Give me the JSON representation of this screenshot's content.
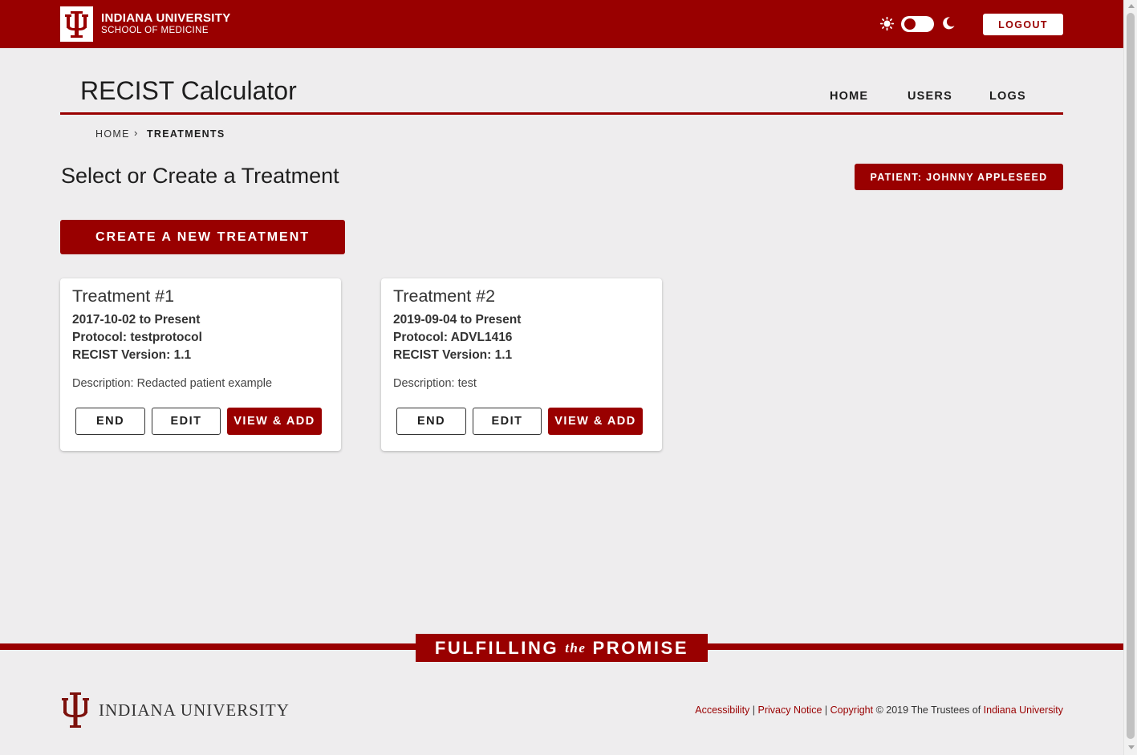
{
  "header": {
    "brand_line1": "INDIANA UNIVERSITY",
    "brand_line2": "SCHOOL OF MEDICINE",
    "logout_label": "LOGOUT",
    "theme_toggle_state": "light"
  },
  "app": {
    "title": "RECIST Calculator",
    "nav": [
      {
        "label": "HOME"
      },
      {
        "label": "USERS"
      },
      {
        "label": "LOGS"
      }
    ]
  },
  "breadcrumb": {
    "home": "HOME",
    "separator": "›",
    "current": "TREATMENTS"
  },
  "page": {
    "title": "Select or Create a Treatment",
    "patient_badge": "PATIENT: JOHNNY APPLESEED",
    "create_button": "CREATE A NEW TREATMENT"
  },
  "treatments": [
    {
      "title": "Treatment #1",
      "dates": "2017-10-02 to Present",
      "protocol": "Protocol: testprotocol",
      "recist": "RECIST Version: 1.1",
      "description": "Description: Redacted patient example",
      "end_label": "END",
      "edit_label": "EDIT",
      "view_label": "VIEW & ADD"
    },
    {
      "title": "Treatment #2",
      "dates": "2019-09-04 to Present",
      "protocol": "Protocol: ADVL1416",
      "recist": "RECIST Version: 1.1",
      "description": "Description: test",
      "end_label": "END",
      "edit_label": "EDIT",
      "view_label": "VIEW & ADD"
    }
  ],
  "footer": {
    "banner_left": "FULFILLING",
    "banner_the": "the",
    "banner_right": "PROMISE",
    "wordmark": "INDIANA UNIVERSITY",
    "accessibility": "Accessibility",
    "sep1": " | ",
    "privacy": "Privacy Notice",
    "sep2": " | ",
    "copyright": "Copyright",
    "copyright_text": " © 2019 The Trustees of ",
    "iu_link": "Indiana University"
  },
  "colors": {
    "brand": "#990000",
    "background": "#eeedee"
  }
}
